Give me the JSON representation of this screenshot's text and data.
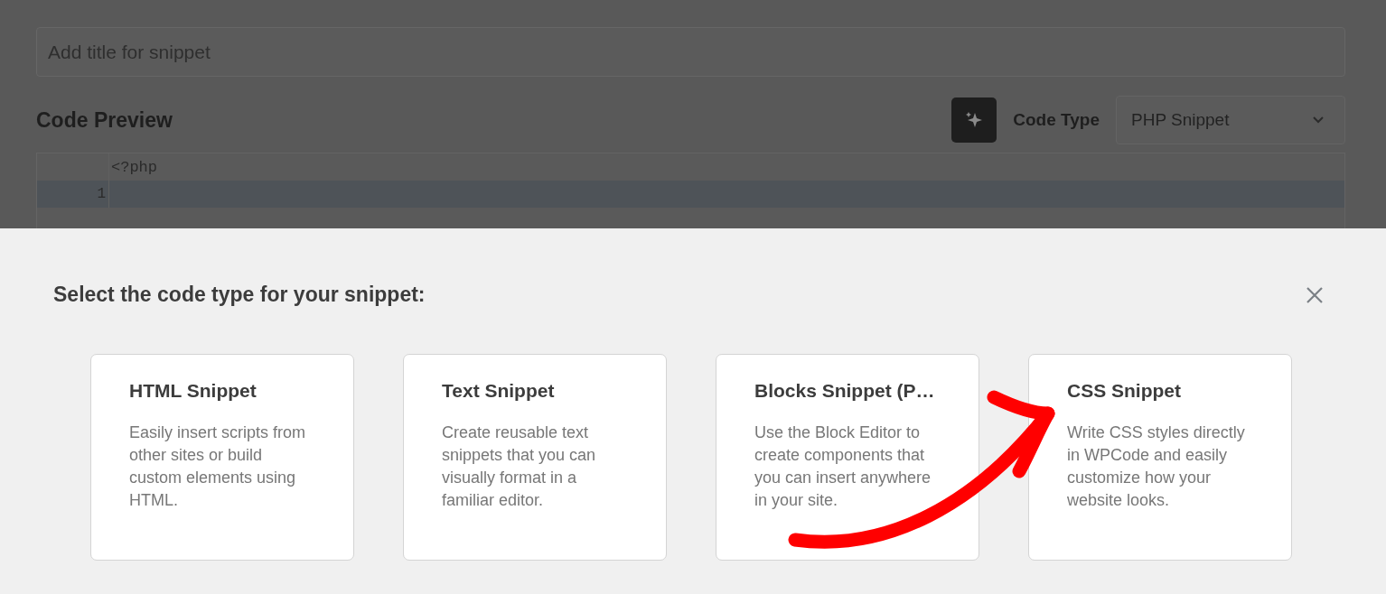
{
  "editor": {
    "title_field": {
      "placeholder": "Add title for snippet"
    },
    "section_title": "Code Preview",
    "code_type_label": "Code Type",
    "code_type_value": "PHP Snippet",
    "code_lines": [
      {
        "text": "<?php",
        "highlighted": false
      },
      {
        "number": "1",
        "highlighted": true
      }
    ]
  },
  "modal": {
    "title": "Select the code type for your snippet:",
    "cards": [
      {
        "title": "HTML Snippet",
        "description": "Easily insert scripts from other sites or build custom elements using HTML."
      },
      {
        "title": "Text Snippet",
        "description": "Create reusable text snippets that you can visually format in a familiar editor."
      },
      {
        "title": "Blocks Snippet (P…",
        "description": "Use the Block Editor to create components that you can insert anywhere in your site."
      },
      {
        "title": "CSS Snippet",
        "description": "Write CSS styles directly in WPCode and easily customize how your website looks."
      }
    ]
  }
}
